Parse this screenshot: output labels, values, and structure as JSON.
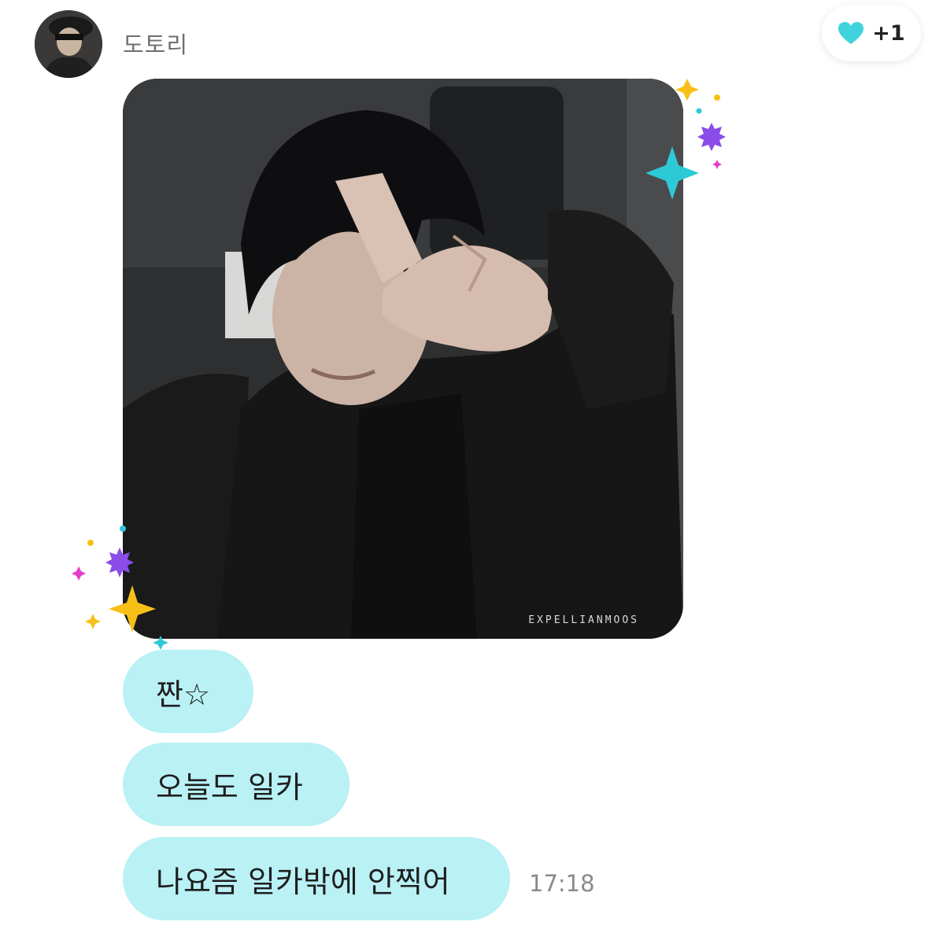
{
  "sender": {
    "name": "도토리",
    "avatar_icon": "profile-photo"
  },
  "reaction": {
    "icon": "heart-icon",
    "color": "#3fd3de",
    "count": "+1"
  },
  "photo": {
    "watermark": "EXPELLIANMOOS"
  },
  "messages": [
    {
      "text": "짠☆"
    },
    {
      "text": "오늘도 일카"
    },
    {
      "text": "나요즘 일카밖에 안찍어"
    }
  ],
  "timestamp": "17:18",
  "colors": {
    "bubble": "#b9f1f5",
    "accent": "#3fd3de"
  }
}
